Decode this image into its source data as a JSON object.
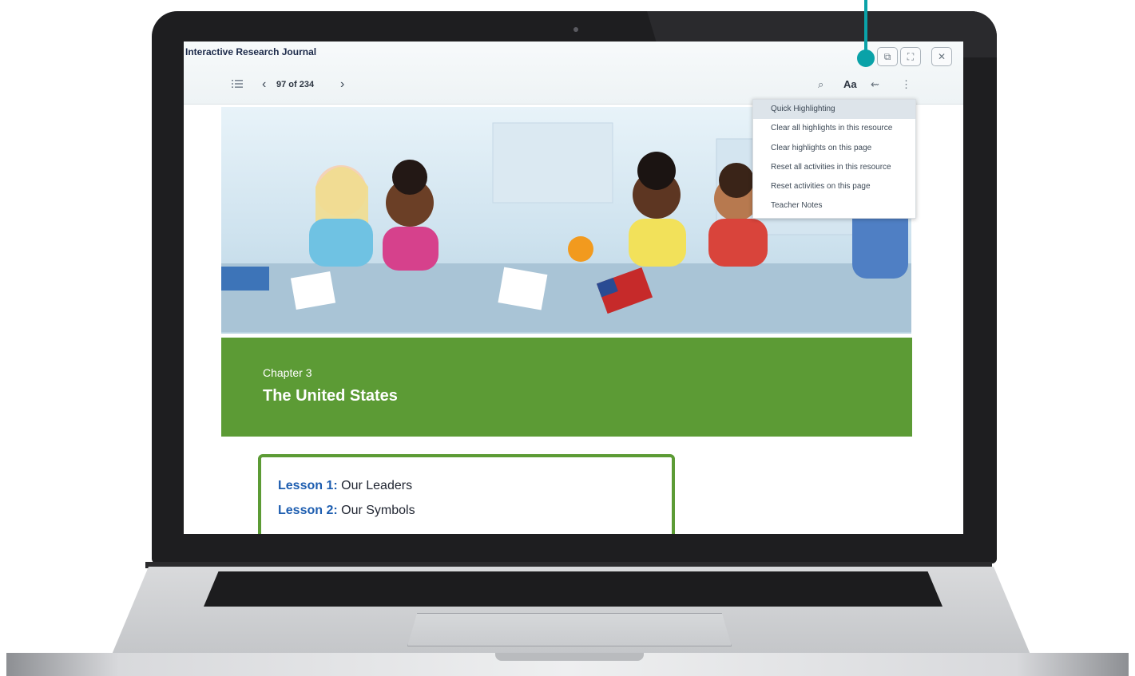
{
  "app": {
    "title": "Interactive Research Journal"
  },
  "window_controls": {
    "open_external_icon": "open-in-new-icon",
    "fullscreen_icon": "fullscreen-icon",
    "close_icon": "close-icon",
    "open_external_glyph": "⧉",
    "fullscreen_glyph": "⛶",
    "close_glyph": "✕"
  },
  "toolbar": {
    "page_indicator": "97 of 234",
    "prev_glyph": "‹",
    "next_glyph": "›",
    "search_glyph": "⌕",
    "font_size_label": "Aa",
    "back_glyph": "⇜",
    "more_glyph": "⋮"
  },
  "menu": {
    "items": [
      {
        "label": "Quick Highlighting",
        "active": true
      },
      {
        "label": "Clear all highlights in this resource",
        "active": false
      },
      {
        "label": "Clear highlights on this page",
        "active": false
      },
      {
        "label": "Reset all activities in this resource",
        "active": false
      },
      {
        "label": "Reset activities on this page",
        "active": false
      },
      {
        "label": "Teacher Notes",
        "active": false
      }
    ]
  },
  "content": {
    "chapter_label": "Chapter 3",
    "chapter_title": "The United States",
    "lessons": [
      {
        "label": "Lesson 1:",
        "title": "Our Leaders"
      },
      {
        "label": "Lesson 2:",
        "title": "Our Symbols"
      }
    ]
  },
  "colors": {
    "accent_teal": "#0aa2a8",
    "banner_green": "#5c9b35",
    "lesson_blue": "#1e5eb0"
  }
}
